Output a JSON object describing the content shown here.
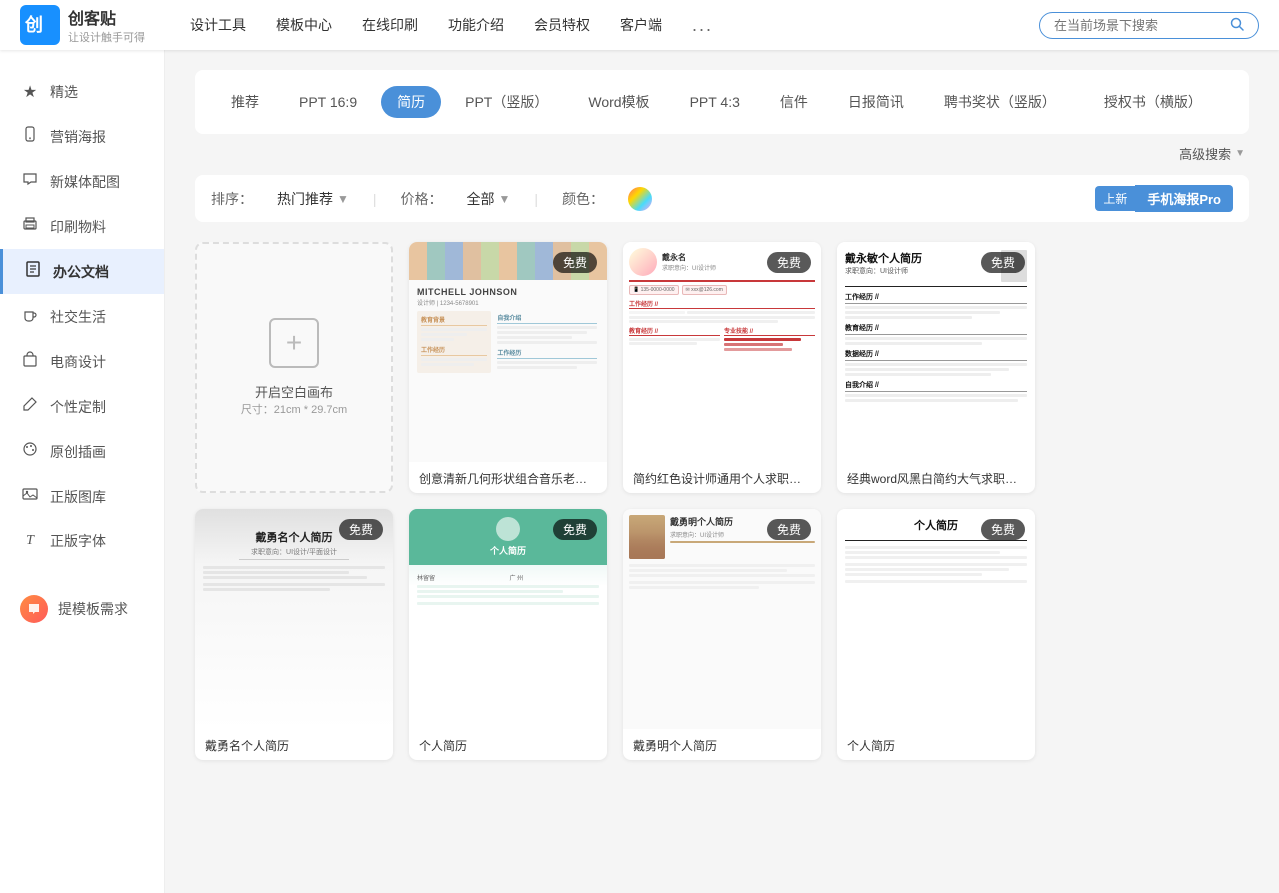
{
  "app": {
    "logo_main": "创客贴",
    "logo_sub": "让设计触手可得"
  },
  "nav": {
    "links": [
      "设计工具",
      "模板中心",
      "在线印刷",
      "功能介绍",
      "会员特权",
      "客户端",
      "..."
    ],
    "search_placeholder": "在当前场景下搜索"
  },
  "sidebar": {
    "items": [
      {
        "id": "featured",
        "label": "精选",
        "icon": "★"
      },
      {
        "id": "marketing",
        "label": "营销海报",
        "icon": "📱"
      },
      {
        "id": "newmedia",
        "label": "新媒体配图",
        "icon": "💬"
      },
      {
        "id": "print",
        "label": "印刷物料",
        "icon": "🖨"
      },
      {
        "id": "office",
        "label": "办公文档",
        "icon": "≡",
        "active": true
      },
      {
        "id": "social",
        "label": "社交生活",
        "icon": "☕"
      },
      {
        "id": "ecommerce",
        "label": "电商设计",
        "icon": "🛍"
      },
      {
        "id": "custom",
        "label": "个性定制",
        "icon": "✏"
      },
      {
        "id": "illustration",
        "label": "原创插画",
        "icon": "🎨"
      },
      {
        "id": "photolibrary",
        "label": "正版图库",
        "icon": "🖼"
      },
      {
        "id": "fonts",
        "label": "正版字体",
        "icon": "T"
      }
    ],
    "feedback_label": "提模板需求"
  },
  "tabs": {
    "items": [
      {
        "id": "recommended",
        "label": "推荐"
      },
      {
        "id": "ppt169",
        "label": "PPT 16:9"
      },
      {
        "id": "resume",
        "label": "简历",
        "active": true
      },
      {
        "id": "pptvert",
        "label": "PPT（竖版）"
      },
      {
        "id": "word",
        "label": "Word模板"
      },
      {
        "id": "ppt43",
        "label": "PPT 4:3"
      },
      {
        "id": "letter",
        "label": "信件"
      },
      {
        "id": "daily",
        "label": "日报简讯"
      },
      {
        "id": "certificate",
        "label": "聘书奖状（竖版）"
      },
      {
        "id": "authorization",
        "label": "授权书（横版）"
      }
    ]
  },
  "filter": {
    "sort_label": "排序：",
    "sort_value": "热门推荐",
    "price_label": "价格：",
    "price_value": "全部",
    "color_label": "颜色：",
    "advanced_label": "高级搜索",
    "promo_new": "上新",
    "promo_title": "手机海报Pro"
  },
  "blank_canvas": {
    "label": "开启空白画布",
    "size": "尺寸：21cm * 29.7cm"
  },
  "templates": [
    {
      "id": "t1",
      "name": "创意清新几何形状组合音乐老师简历...",
      "free": true,
      "type": "colorful"
    },
    {
      "id": "t2",
      "name": "简约红色设计师通用个人求职简历模板",
      "free": true,
      "type": "red-chinese"
    },
    {
      "id": "t3",
      "name": "经典word风黑白简约大气求职简历",
      "free": true,
      "type": "classic-bw"
    },
    {
      "id": "b1",
      "name": "戴勇名个人简历",
      "free": true,
      "type": "gray-formal"
    },
    {
      "id": "b2",
      "name": "个人简历",
      "free": true,
      "type": "green-personal"
    },
    {
      "id": "b3",
      "name": "戴勇明个人简历",
      "free": true,
      "type": "photo-formal"
    },
    {
      "id": "b4",
      "name": "个人简历",
      "free": true,
      "type": "classic-word"
    }
  ]
}
